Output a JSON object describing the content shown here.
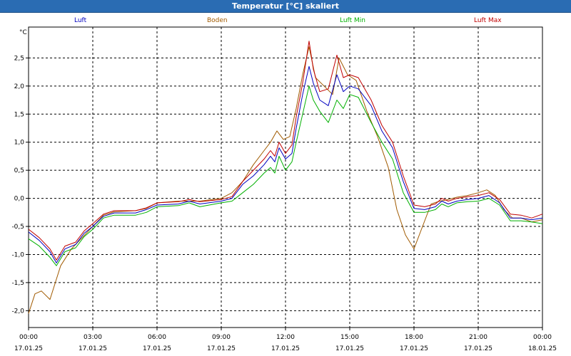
{
  "window": {
    "title": "Temperatur [°C] skaliert"
  },
  "chart_data": {
    "type": "line",
    "title": "Temperatur [°C] skaliert",
    "ylabel": "°C",
    "xlabel": "",
    "ylim": [
      -2.3,
      3.05
    ],
    "xlim_hours": [
      0,
      24
    ],
    "yticks": [
      "-2,0",
      "-1,5",
      "-1,0",
      "-0,5",
      "0,0",
      "0,5",
      "1,0",
      "1,5",
      "2,0",
      "2,5"
    ],
    "ytick_values": [
      -2.0,
      -1.5,
      -1.0,
      -0.5,
      0.0,
      0.5,
      1.0,
      1.5,
      2.0,
      2.5
    ],
    "xticks": [
      {
        "time": "00:00",
        "date": "17.01.25"
      },
      {
        "time": "03:00",
        "date": "17.01.25"
      },
      {
        "time": "06:00",
        "date": "17.01.25"
      },
      {
        "time": "09:00",
        "date": "17.01.25"
      },
      {
        "time": "12:00",
        "date": "17.01.25"
      },
      {
        "time": "15:00",
        "date": "17.01.25"
      },
      {
        "time": "18:00",
        "date": "17.01.25"
      },
      {
        "time": "21:00",
        "date": "17.01.25"
      },
      {
        "time": "00:00",
        "date": "18.01.25"
      }
    ],
    "grid": true,
    "legend_position": "top",
    "series": [
      {
        "name": "Luft",
        "color": "#0000c0",
        "points": [
          [
            0,
            -0.6
          ],
          [
            0.5,
            -0.75
          ],
          [
            1,
            -0.95
          ],
          [
            1.3,
            -1.15
          ],
          [
            1.7,
            -0.9
          ],
          [
            2.2,
            -0.82
          ],
          [
            2.6,
            -0.62
          ],
          [
            3,
            -0.5
          ],
          [
            3.5,
            -0.32
          ],
          [
            4,
            -0.26
          ],
          [
            5,
            -0.26
          ],
          [
            5.5,
            -0.2
          ],
          [
            6,
            -0.12
          ],
          [
            7,
            -0.1
          ],
          [
            7.5,
            -0.05
          ],
          [
            8,
            -0.1
          ],
          [
            9,
            -0.05
          ],
          [
            9.5,
            0.0
          ],
          [
            10,
            0.25
          ],
          [
            10.5,
            0.4
          ],
          [
            11,
            0.6
          ],
          [
            11.3,
            0.75
          ],
          [
            11.5,
            0.65
          ],
          [
            11.7,
            0.9
          ],
          [
            12,
            0.7
          ],
          [
            12.3,
            0.8
          ],
          [
            12.5,
            1.25
          ],
          [
            12.8,
            1.85
          ],
          [
            13.1,
            2.35
          ],
          [
            13.3,
            2.05
          ],
          [
            13.6,
            1.75
          ],
          [
            14,
            1.65
          ],
          [
            14.4,
            2.2
          ],
          [
            14.7,
            1.9
          ],
          [
            15,
            2.0
          ],
          [
            15.4,
            1.95
          ],
          [
            16,
            1.65
          ],
          [
            16.5,
            1.2
          ],
          [
            17,
            0.9
          ],
          [
            17.5,
            0.3
          ],
          [
            18,
            -0.18
          ],
          [
            18.5,
            -0.2
          ],
          [
            19,
            -0.15
          ],
          [
            19.3,
            -0.05
          ],
          [
            19.6,
            -0.1
          ],
          [
            20,
            -0.05
          ],
          [
            20.5,
            -0.02
          ],
          [
            21,
            0.0
          ],
          [
            21.5,
            0.05
          ],
          [
            22,
            -0.08
          ],
          [
            22.5,
            -0.35
          ],
          [
            23,
            -0.35
          ],
          [
            23.5,
            -0.38
          ],
          [
            24,
            -0.35
          ]
        ]
      },
      {
        "name": "Boden",
        "color": "#a05a00",
        "points": [
          [
            0,
            -2.05
          ],
          [
            0.3,
            -1.7
          ],
          [
            0.6,
            -1.65
          ],
          [
            1,
            -1.8
          ],
          [
            1.5,
            -1.2
          ],
          [
            2,
            -0.9
          ],
          [
            2.5,
            -0.7
          ],
          [
            3,
            -0.5
          ],
          [
            3.5,
            -0.3
          ],
          [
            4,
            -0.24
          ],
          [
            5,
            -0.22
          ],
          [
            5.5,
            -0.18
          ],
          [
            6,
            -0.08
          ],
          [
            7,
            -0.05
          ],
          [
            8,
            -0.05
          ],
          [
            9,
            0.0
          ],
          [
            9.5,
            0.1
          ],
          [
            10,
            0.3
          ],
          [
            10.5,
            0.6
          ],
          [
            11,
            0.85
          ],
          [
            11.3,
            1.0
          ],
          [
            11.6,
            1.2
          ],
          [
            11.9,
            1.05
          ],
          [
            12.2,
            1.1
          ],
          [
            12.5,
            1.6
          ],
          [
            12.8,
            2.2
          ],
          [
            13.1,
            2.7
          ],
          [
            13.4,
            2.15
          ],
          [
            13.8,
            2.0
          ],
          [
            14.2,
            1.85
          ],
          [
            14.5,
            2.5
          ],
          [
            14.9,
            2.2
          ],
          [
            15.3,
            2.1
          ],
          [
            15.8,
            1.55
          ],
          [
            16.3,
            1.1
          ],
          [
            16.8,
            0.55
          ],
          [
            17.2,
            -0.2
          ],
          [
            17.6,
            -0.65
          ],
          [
            18,
            -0.9
          ],
          [
            18.4,
            -0.5
          ],
          [
            18.8,
            -0.1
          ],
          [
            19.2,
            -0.05
          ],
          [
            19.6,
            -0.02
          ],
          [
            20,
            0.02
          ],
          [
            20.5,
            0.05
          ],
          [
            21,
            0.1
          ],
          [
            21.4,
            0.15
          ],
          [
            21.8,
            0.05
          ],
          [
            22.2,
            -0.2
          ],
          [
            22.6,
            -0.35
          ],
          [
            23,
            -0.35
          ],
          [
            23.5,
            -0.42
          ],
          [
            24,
            -0.38
          ]
        ]
      },
      {
        "name": "Luft Min",
        "color": "#00b000",
        "points": [
          [
            0,
            -0.72
          ],
          [
            0.5,
            -0.85
          ],
          [
            1,
            -1.05
          ],
          [
            1.3,
            -1.2
          ],
          [
            1.7,
            -0.95
          ],
          [
            2.2,
            -0.88
          ],
          [
            2.6,
            -0.68
          ],
          [
            3,
            -0.55
          ],
          [
            3.5,
            -0.35
          ],
          [
            4,
            -0.3
          ],
          [
            5,
            -0.3
          ],
          [
            5.5,
            -0.25
          ],
          [
            6,
            -0.15
          ],
          [
            7,
            -0.13
          ],
          [
            7.5,
            -0.08
          ],
          [
            8,
            -0.15
          ],
          [
            9,
            -0.08
          ],
          [
            9.5,
            -0.05
          ],
          [
            10,
            0.1
          ],
          [
            10.5,
            0.25
          ],
          [
            11,
            0.45
          ],
          [
            11.3,
            0.55
          ],
          [
            11.5,
            0.45
          ],
          [
            11.7,
            0.75
          ],
          [
            12,
            0.5
          ],
          [
            12.3,
            0.65
          ],
          [
            12.5,
            1.0
          ],
          [
            12.8,
            1.5
          ],
          [
            13.1,
            2.0
          ],
          [
            13.3,
            1.75
          ],
          [
            13.6,
            1.55
          ],
          [
            14,
            1.35
          ],
          [
            14.4,
            1.75
          ],
          [
            14.7,
            1.6
          ],
          [
            15,
            1.85
          ],
          [
            15.4,
            1.8
          ],
          [
            16,
            1.35
          ],
          [
            16.5,
            1.0
          ],
          [
            17,
            0.7
          ],
          [
            17.5,
            0.1
          ],
          [
            18,
            -0.25
          ],
          [
            18.5,
            -0.25
          ],
          [
            19,
            -0.2
          ],
          [
            19.3,
            -0.1
          ],
          [
            19.6,
            -0.15
          ],
          [
            20,
            -0.08
          ],
          [
            20.5,
            -0.06
          ],
          [
            21,
            -0.05
          ],
          [
            21.5,
            0.0
          ],
          [
            22,
            -0.12
          ],
          [
            22.5,
            -0.4
          ],
          [
            23,
            -0.4
          ],
          [
            23.5,
            -0.42
          ],
          [
            24,
            -0.45
          ]
        ]
      },
      {
        "name": "Luft Max",
        "color": "#c00000",
        "points": [
          [
            0,
            -0.55
          ],
          [
            0.5,
            -0.7
          ],
          [
            1,
            -0.9
          ],
          [
            1.3,
            -1.1
          ],
          [
            1.7,
            -0.85
          ],
          [
            2.2,
            -0.78
          ],
          [
            2.6,
            -0.58
          ],
          [
            3,
            -0.45
          ],
          [
            3.5,
            -0.28
          ],
          [
            4,
            -0.22
          ],
          [
            5,
            -0.22
          ],
          [
            5.5,
            -0.17
          ],
          [
            6,
            -0.08
          ],
          [
            7,
            -0.06
          ],
          [
            7.5,
            -0.02
          ],
          [
            8,
            -0.06
          ],
          [
            9,
            -0.02
          ],
          [
            9.5,
            0.03
          ],
          [
            10,
            0.3
          ],
          [
            10.5,
            0.5
          ],
          [
            11,
            0.7
          ],
          [
            11.3,
            0.85
          ],
          [
            11.5,
            0.75
          ],
          [
            11.7,
            1.0
          ],
          [
            12,
            0.8
          ],
          [
            12.3,
            0.95
          ],
          [
            12.5,
            1.45
          ],
          [
            12.8,
            2.05
          ],
          [
            13.1,
            2.8
          ],
          [
            13.3,
            2.3
          ],
          [
            13.6,
            1.9
          ],
          [
            14,
            1.95
          ],
          [
            14.4,
            2.55
          ],
          [
            14.7,
            2.15
          ],
          [
            15,
            2.2
          ],
          [
            15.4,
            2.15
          ],
          [
            16,
            1.75
          ],
          [
            16.5,
            1.3
          ],
          [
            17,
            1.0
          ],
          [
            17.5,
            0.4
          ],
          [
            18,
            -0.12
          ],
          [
            18.5,
            -0.15
          ],
          [
            19,
            -0.1
          ],
          [
            19.3,
            0.0
          ],
          [
            19.6,
            -0.05
          ],
          [
            20,
            0.0
          ],
          [
            20.5,
            0.03
          ],
          [
            21,
            0.05
          ],
          [
            21.5,
            0.1
          ],
          [
            22,
            -0.02
          ],
          [
            22.5,
            -0.28
          ],
          [
            23,
            -0.3
          ],
          [
            23.5,
            -0.35
          ],
          [
            24,
            -0.28
          ]
        ]
      }
    ]
  }
}
